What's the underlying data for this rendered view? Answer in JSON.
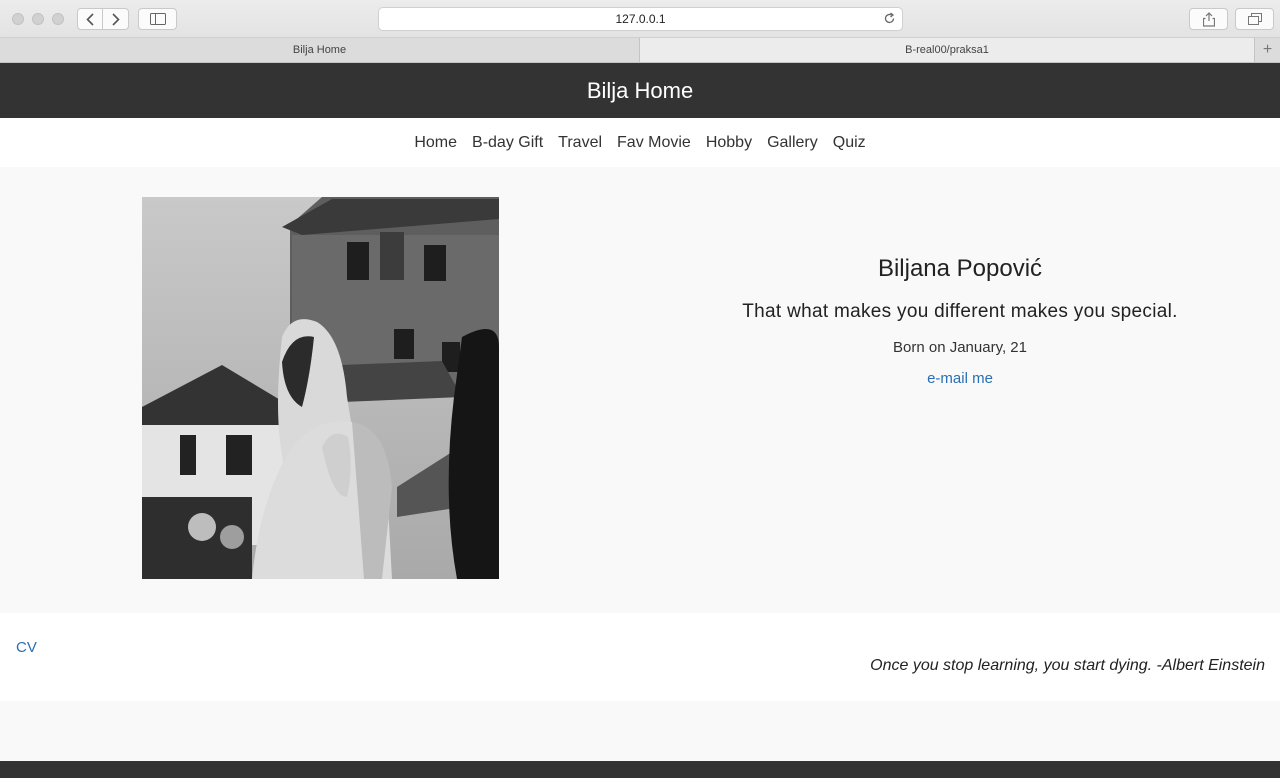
{
  "browser": {
    "url": "127.0.0.1",
    "tabs": [
      {
        "label": "Bilja Home"
      },
      {
        "label": "B-real00/praksa1"
      }
    ],
    "new_tab": "+"
  },
  "header": {
    "title": "Bilja Home"
  },
  "nav": {
    "items": [
      "Home",
      "B-day Gift",
      "Travel",
      "Fav Movie",
      "Hobby",
      "Gallery",
      "Quiz"
    ]
  },
  "profile": {
    "name": "Biljana Popović",
    "motto": "That what makes you different makes you special.",
    "born": "Born on January, 21",
    "email_link": "e-mail me"
  },
  "footer": {
    "cv_link": "CV",
    "quote": "Once you stop learning, you start dying. -Albert Einstein"
  },
  "colors": {
    "header_bg": "#333333",
    "link": "#2a6fb5",
    "page_bg": "#f9f9f9"
  }
}
